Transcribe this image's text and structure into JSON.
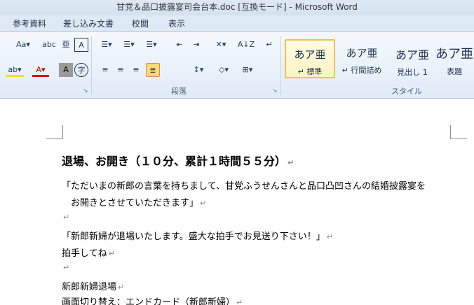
{
  "window": {
    "title": "甘党＆品口披露宴司会台本.doc [互換モード] - Microsoft Word"
  },
  "tabs": [
    {
      "label": "参考資料"
    },
    {
      "label": "差し込み文書"
    },
    {
      "label": "校閲"
    },
    {
      "label": "表示"
    }
  ],
  "ribbon": {
    "paragraph_group_label": "段落",
    "styles_group_label": "スタイル",
    "font_row1": [
      "Aa▾",
      "abc",
      "亜",
      "A"
    ],
    "font_row2": [
      "ab▾",
      "A▾",
      "A",
      "字"
    ],
    "para_row1": [
      "☰▾",
      "☰▾",
      "☰▾",
      "⇤",
      "⇥",
      "✕▾",
      "A↓Z",
      "↵"
    ],
    "para_row2": [
      "≡",
      "≡",
      "≡",
      "≣",
      "↕▾",
      "◇▾",
      "⊞▾"
    ],
    "styles": [
      {
        "sample": "あア亜",
        "name": "↵ 標準"
      },
      {
        "sample": "あア亜",
        "name": "↵ 行間詰め"
      },
      {
        "sample": "あア亜",
        "name": "見出し 1"
      },
      {
        "sample": "あア亜",
        "name": "表題"
      }
    ]
  },
  "document": {
    "paragraph_mark": "↵",
    "lines": [
      {
        "text": "退場、お開き（１０分、累計１時間５５分）",
        "heading": true
      },
      {
        "text": "「ただいまの新郎の言葉を持ちまして、甘党ふうせんさんと品口凸凹さんの結婚披露宴を",
        "mark": false
      },
      {
        "text": "　お開きとさせていただきます」",
        "mark": true
      },
      {
        "text": "",
        "mark": true
      },
      {
        "text": "「新郎新婦が退場いたします。盛大な拍手でお見送り下さい！」",
        "mark": true
      },
      {
        "text": "拍手してね",
        "mark": true
      },
      {
        "text": "",
        "mark": true
      },
      {
        "text": "新郎新婦退場",
        "mark": true
      },
      {
        "text": "画面切り替え：エンドカード（新郎新婦）",
        "mark": true
      }
    ]
  }
}
